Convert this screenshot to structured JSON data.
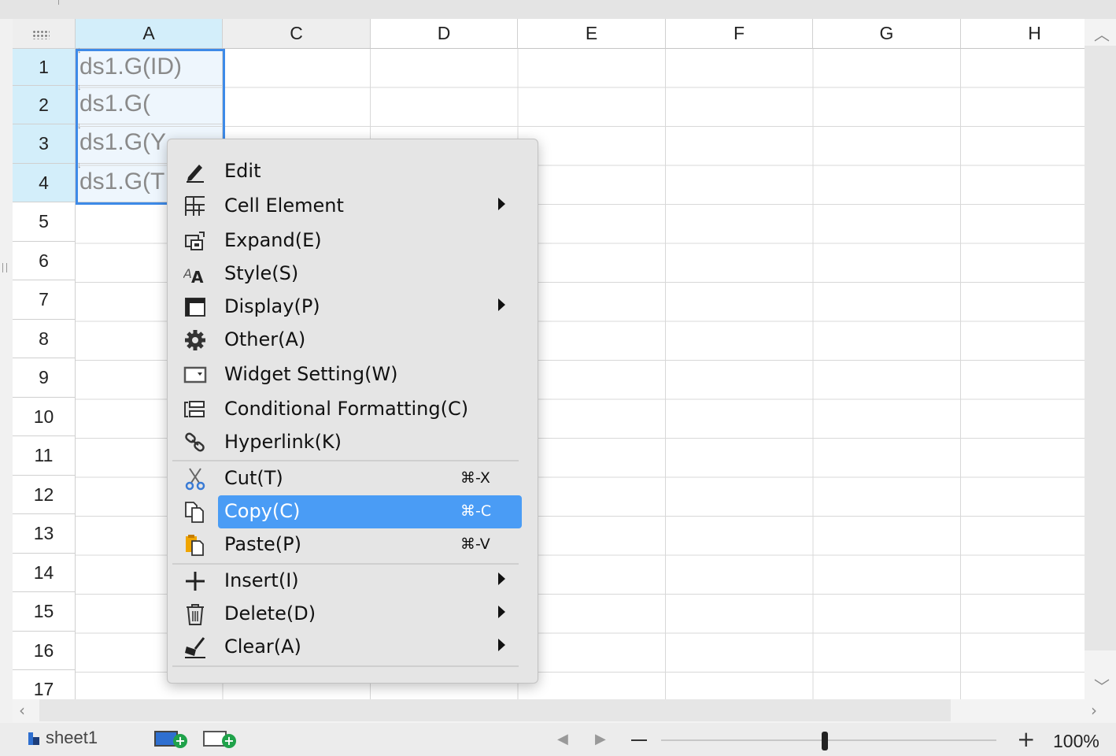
{
  "columns": [
    "A",
    "C",
    "D",
    "E",
    "F",
    "G",
    "H"
  ],
  "rows": [
    "1",
    "2",
    "3",
    "4",
    "5",
    "6",
    "7",
    "8",
    "9",
    "10",
    "11",
    "12",
    "13",
    "14",
    "15",
    "16",
    "17"
  ],
  "cells": {
    "a1": "ds1.G(ID)",
    "a2": "ds1.G(",
    "a3": "ds1.G(Y",
    "a4": "ds1.G(T"
  },
  "context_menu": {
    "items": [
      {
        "label": "Edit",
        "icon": "pencil-icon"
      },
      {
        "label": "Cell Element",
        "icon": "grid-icon",
        "submenu": true
      },
      {
        "label": "Expand(E)",
        "icon": "expand-icon"
      },
      {
        "label": "Style(S)",
        "icon": "style-icon"
      },
      {
        "label": "Display(P)",
        "icon": "display-icon",
        "submenu": true
      },
      {
        "label": "Other(A)",
        "icon": "gear-icon"
      },
      {
        "label": "Widget Setting(W)",
        "icon": "widget-icon"
      },
      {
        "label": "Conditional Formatting(C)",
        "icon": "conditional-icon"
      },
      {
        "label": "Hyperlink(K)",
        "icon": "link-icon"
      },
      {
        "label": "Cut(T)",
        "icon": "scissors-icon",
        "shortcut": "⌘-X"
      },
      {
        "label": "Copy(C)",
        "icon": "copy-icon",
        "shortcut": "⌘-C",
        "highlighted": true
      },
      {
        "label": "Paste(P)",
        "icon": "paste-icon",
        "shortcut": "⌘-V"
      },
      {
        "label": "Insert(I)",
        "icon": "plus-icon",
        "submenu": true
      },
      {
        "label": "Delete(D)",
        "icon": "trash-icon",
        "submenu": true
      },
      {
        "label": "Clear(A)",
        "icon": "broom-icon",
        "submenu": true
      }
    ]
  },
  "status": {
    "sheet_name": "sheet1",
    "zoom": "100%",
    "zoom_minus": "—",
    "zoom_plus": "+"
  },
  "colors": {
    "selection": "#3d8ae8",
    "header_selected": "#d3eefa",
    "highlight": "#4a9cf5"
  }
}
